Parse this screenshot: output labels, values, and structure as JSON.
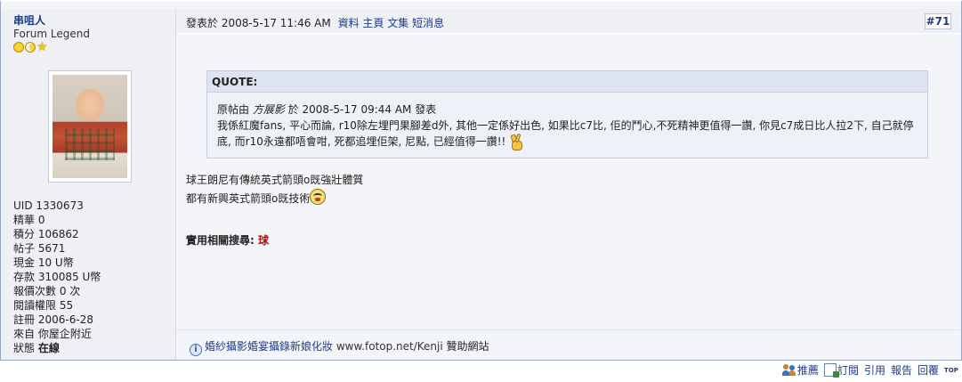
{
  "author": {
    "name": "串咀人",
    "title": "Forum Legend",
    "stats": [
      {
        "label": "UID",
        "value": "1330673"
      },
      {
        "label": "精華",
        "value": "0"
      },
      {
        "label": "積分",
        "value": "106862"
      },
      {
        "label": "帖子",
        "value": "5671"
      },
      {
        "label": "現金",
        "value": "10 U幣"
      },
      {
        "label": "存款",
        "value": "310085 U幣"
      },
      {
        "label": "報價次數",
        "value": "0 次"
      },
      {
        "label": "閱讀權限",
        "value": "55"
      },
      {
        "label": "註冊",
        "value": "2006-6-28"
      },
      {
        "label": "來自",
        "value": "你屋企附近"
      },
      {
        "label": "狀態",
        "value": "在線"
      }
    ]
  },
  "header": {
    "posted_label": "發表於",
    "posted_time": "2008-5-17 11:46 AM",
    "links": [
      "資料",
      "主頁",
      "文集",
      "短消息"
    ],
    "post_number": "#71"
  },
  "quote": {
    "heading": "QUOTE:",
    "prefix": "原帖由",
    "author": "方展影",
    "on": "於",
    "time": "2008-5-17 09:44 AM",
    "suffix": "發表",
    "line1": "我係紅魔fans, 平心而論, r10除左埋門果腳差d外, 其他一定係好出色, 如果比c7比, 佢的鬥心,不死精神更值得一讚, 你見c7成日比人拉2下, 自己就停",
    "line2": "底, 而r10永遠都唔會咁, 死都追埋佢架, 尼點, 已經值得一讚!!"
  },
  "message": {
    "line1": "球王朗尼有傳統英式箭頭o既強壯體質",
    "line2": "都有新興英式箭頭o既技術"
  },
  "related": {
    "label": "實用相關搜尋:",
    "link": "球"
  },
  "sponsor": {
    "text": "婚紗攝影婚宴攝錄新娘化妝",
    "url": "www.fotop.net/Kenji",
    "suffix": "贊助網站"
  },
  "actions": {
    "recommend": "推薦",
    "subscribe": "訂閱",
    "quote": "引用",
    "report": "報告",
    "reply": "回覆",
    "top": "TOP"
  }
}
